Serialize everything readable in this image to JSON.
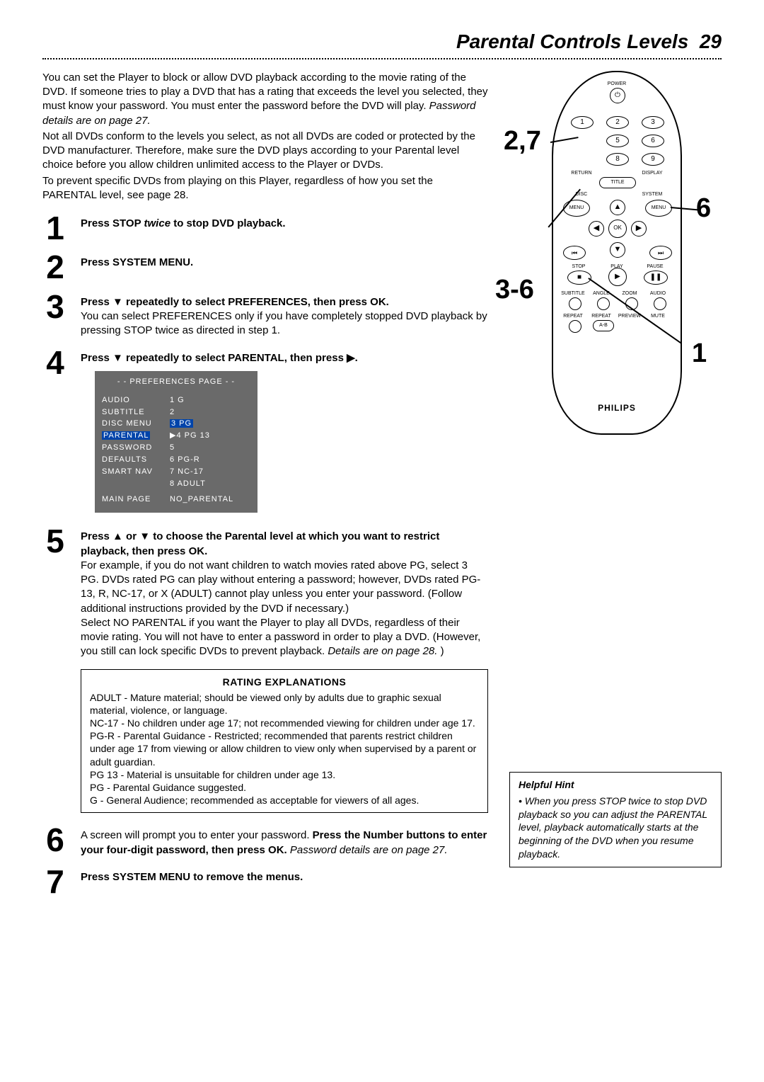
{
  "title": "Parental Controls Levels",
  "page_num": "29",
  "intro": {
    "p1": "You can set the Player to block or allow DVD playback according to the movie rating of the DVD. If someone tries to play a DVD that has a rating that exceeds the level you selected, they must know your password.  You must enter the password before the DVD will play. ",
    "p1_italic": "Password details are on page 27.",
    "p2": "Not all DVDs conform to the levels you select, as not all DVDs are coded or protected by the DVD manufacturer.  Therefore, make sure the DVD plays according to your Parental level choice before you allow children unlimited access to the Player or DVDs.",
    "p3": "To prevent specific DVDs from playing on this Player, regardless of how you set the PARENTAL level, see page 28."
  },
  "steps": {
    "s1_num": "1",
    "s1_a": "Press STOP ",
    "s1_b": "twice",
    "s1_c": " to stop DVD playback.",
    "s2_num": "2",
    "s2": "Press SYSTEM MENU.",
    "s3_num": "3",
    "s3_bold": "Press ▼ repeatedly to select PREFERENCES, then press OK.",
    "s3_body": "You can select PREFERENCES only if you have completely stopped DVD playback by pressing STOP      twice as directed in step 1.",
    "s4_num": "4",
    "s4_bold": "Press ▼ repeatedly to select PARENTAL, then press ▶.",
    "s5_num": "5",
    "s5_bold": "Press ▲ or ▼ to choose the Parental level at which you want to restrict playback, then press OK.",
    "s5_body1": "For example, if you do not want children to watch movies rated above PG, select 3 PG. DVDs rated PG can play without entering a password; however, DVDs rated PG-13, R, NC-17, or X (ADULT) cannot play unless you enter your password. (Follow additional instructions provided by the DVD if necessary.)",
    "s5_body2": "Select NO PARENTAL if you want the Player to play all DVDs, regardless of their movie rating. You will not have to enter a password in order to play a DVD. (However, you still can lock specific DVDs to prevent playback. ",
    "s5_body2_it": "Details are on page 28.",
    "s5_body2_end": ")",
    "s6_num": "6",
    "s6_body_a": "A screen will prompt you to enter your password. ",
    "s6_bold": "Press the Number buttons to enter your four-digit password, then press OK. ",
    "s6_it": "Password details are on page 27.",
    "s7_num": "7",
    "s7_bold": "Press SYSTEM MENU to remove the menus."
  },
  "menu": {
    "title": "- -  PREFERENCES PAGE  - -",
    "rows": [
      {
        "l": "AUDIO",
        "r": "1  G"
      },
      {
        "l": "SUBTITLE",
        "r": "2"
      },
      {
        "l": "DISC MENU",
        "r": "3  PG",
        "hl_r": true
      },
      {
        "l": "PARENTAL",
        "r": "▶4  PG 13",
        "hl_l": true
      },
      {
        "l": "PASSWORD",
        "r": "5"
      },
      {
        "l": "DEFAULTS",
        "r": "6  PG-R"
      },
      {
        "l": "SMART NAV",
        "r": "7  NC-17"
      },
      {
        "l": "",
        "r": "8  ADULT"
      },
      {
        "l": "MAIN PAGE",
        "r": "NO_PARENTAL",
        "gap": true
      }
    ]
  },
  "ratings": {
    "title": "RATING EXPLANATIONS",
    "items": [
      "ADULT - Mature material; should be viewed only by adults due to graphic sexual material, violence, or language.",
      "NC-17 - No children under age 17; not recommended viewing for children under age 17.",
      "PG-R - Parental Guidance - Restricted; recommended that parents restrict children under age 17 from viewing or allow children to view only when supervised by a parent or adult guardian.",
      "PG 13 - Material is unsuitable for children under age 13.",
      "PG - Parental Guidance suggested.",
      "G - General Audience; recommended as acceptable for viewers of all ages."
    ]
  },
  "hint": {
    "title": "Helpful Hint",
    "body": "• When you press STOP      twice to stop DVD playback so you can adjust the PARENTAL level, playback automatically starts at the beginning of the DVD when you resume playback."
  },
  "remote": {
    "brand": "PHILIPS",
    "callouts": {
      "c27": "2,7",
      "c6": "6",
      "c36": "3-6",
      "c1": "1"
    },
    "labels": {
      "power": "POWER",
      "return": "RETURN",
      "display": "DISPLAY",
      "title": "TITLE",
      "disc": "DISC",
      "system": "SYSTEM",
      "menu_l": "MENU",
      "menu_r": "MENU",
      "ok": "OK",
      "stop": "STOP",
      "play": "PLAY",
      "pause": "PAUSE",
      "subtitle": "SUBTITLE",
      "angle": "ANGLE",
      "zoom": "ZOOM",
      "audio": "AUDIO",
      "repeat": "REPEAT",
      "repeat2": "REPEAT",
      "preview": "PREVIEW",
      "mute": "MUTE",
      "ab": "A-B"
    },
    "nums": [
      "1",
      "2",
      "3",
      "5",
      "6",
      "8",
      "9"
    ]
  }
}
